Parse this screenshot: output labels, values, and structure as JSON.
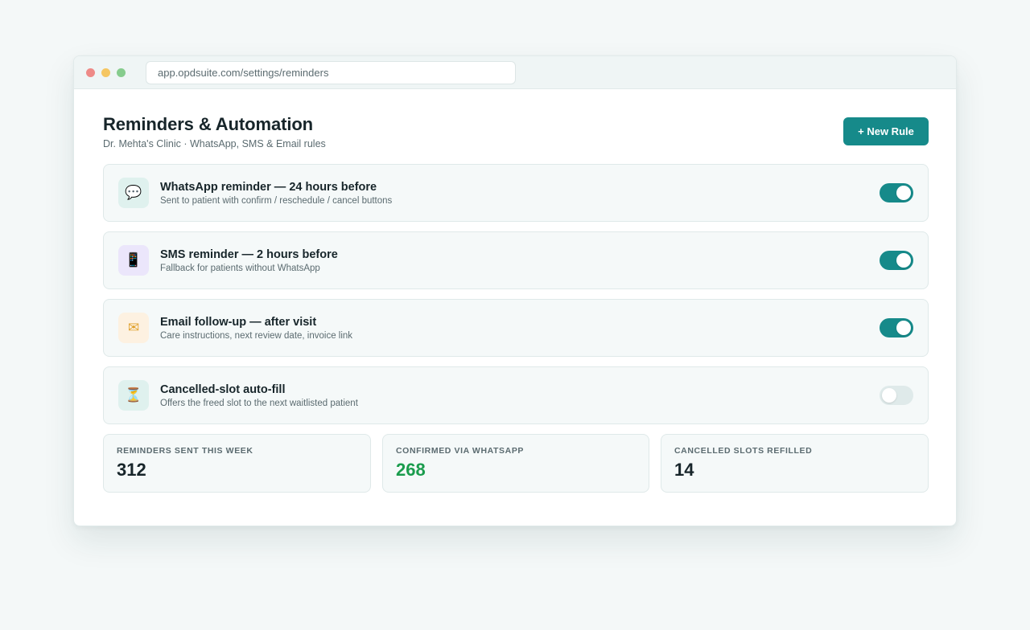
{
  "browser": {
    "url": "app.opdsuite.com/settings/reminders"
  },
  "header": {
    "title": "Reminders & Automation",
    "subtitle": "Dr. Mehta's Clinic · WhatsApp, SMS & Email rules",
    "new_rule_label": "+ New Rule"
  },
  "rules": [
    {
      "icon": "chat-bubble-icon",
      "glyph": "💬",
      "title": "WhatsApp reminder — 24 hours before",
      "description": "Sent to patient with confirm / reschedule / cancel buttons",
      "enabled": true
    },
    {
      "icon": "mobile-phone-icon",
      "glyph": "📱",
      "title": "SMS reminder — 2 hours before",
      "description": "Fallback for patients without WhatsApp",
      "enabled": true
    },
    {
      "icon": "envelope-icon",
      "glyph": "✉",
      "title": "Email follow-up — after visit",
      "description": "Care instructions, next review date, invoice link",
      "enabled": true
    },
    {
      "icon": "hourglass-icon",
      "glyph": "⏳",
      "title": "Cancelled-slot auto-fill",
      "description": "Offers the freed slot to the next waitlisted patient",
      "enabled": false
    }
  ],
  "stats": [
    {
      "label": "Reminders sent this week",
      "value": "312"
    },
    {
      "label": "Confirmed via WhatsApp",
      "value": "268"
    },
    {
      "label": "Cancelled slots refilled",
      "value": "14"
    }
  ],
  "colors": {
    "accent": "#168a8a",
    "positive": "#1a9c4d",
    "toggle_off": "#dfeaea"
  }
}
